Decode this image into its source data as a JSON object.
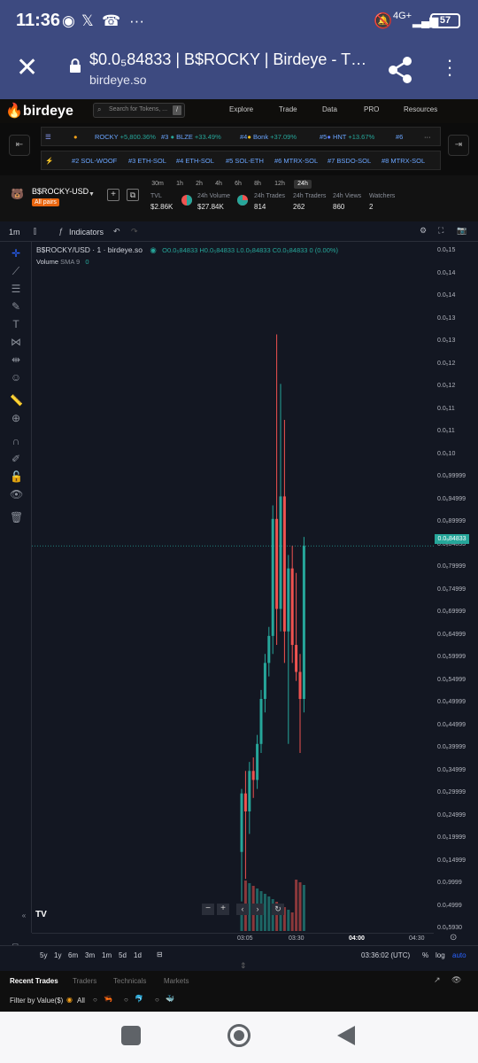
{
  "status": {
    "time": "11:36",
    "network": "4G+",
    "battery": "57"
  },
  "browser": {
    "title": "$0.0₅84833 | B$ROCKY | Birdeye - The ...",
    "url": "birdeye.so"
  },
  "site": {
    "logo": "birdeye",
    "search_placeholder": "Search for Tokens, ...",
    "search_key": "/",
    "menu": [
      "Explore",
      "Trade",
      "Data",
      "PRO",
      "Resources"
    ]
  },
  "ticker1": [
    {
      "rank": "",
      "name": "ROCKY",
      "change": "+5,800.36%"
    },
    {
      "rank": "#3",
      "name": "BLZE",
      "change": "+33.49%"
    },
    {
      "rank": "#4",
      "name": "Bonk",
      "change": "+37.09%"
    },
    {
      "rank": "#5",
      "name": "HNT",
      "change": "+13.67%"
    },
    {
      "rank": "#6",
      "name": "",
      "change": ""
    }
  ],
  "ticker2": [
    "#2 SOL-WOOF",
    "#3 ETH-SOL",
    "#4 ETH-SOL",
    "#5 SOL-ETH",
    "#6 MTRX-SOL",
    "#7 BSDO-SOL",
    "#8 MTRX-SOL"
  ],
  "token": {
    "pair": "B$ROCKY-USD",
    "badge": "All pairs",
    "timeframes": [
      "30m",
      "1h",
      "2h",
      "4h",
      "6h",
      "8h",
      "12h",
      "24h"
    ],
    "active_timeframe": "24h",
    "stats": [
      {
        "label": "TVL",
        "value": "$2.86K"
      },
      {
        "label": "24h Volume",
        "value": "$27.84K"
      },
      {
        "label": "24h Trades",
        "value": "814"
      },
      {
        "label": "24h Traders",
        "value": "262"
      },
      {
        "label": "24h Views",
        "value": "860"
      },
      {
        "label": "Watchers",
        "value": "2"
      }
    ]
  },
  "chart_toolbar": {
    "interval": "1m",
    "indicators": "Indicators"
  },
  "legend": {
    "title": "B$ROCKY/USD · 1 · birdeye.so",
    "ohlc": "O0.0₅84833 H0.0₅84833 L0.0₅84833 C0.0₅84833 0 (0.00%)",
    "volume": "Volume",
    "sma": "SMA 9",
    "sma_val": "0"
  },
  "yaxis_labels": [
    "0.0₅15",
    "0.0₅14",
    "0.0₅14",
    "0.0₅13",
    "0.0₅13",
    "0.0₅12",
    "0.0₅12",
    "0.0₅11",
    "0.0₅11",
    "0.0₅10",
    "0.0₆99999",
    "0.0₆94999",
    "0.0₆89999",
    "0.0₅84833",
    "0.0₆79999",
    "0.0₆74999",
    "0.0₆69999",
    "0.0₆64999",
    "0.0₆59999",
    "0.0₆54999",
    "0.0₆49999",
    "0.0₆44999",
    "0.0₆39999",
    "0.0₆34999",
    "0.0₆29999",
    "0.0₆24999",
    "0.0₆19999",
    "0.0₆14999",
    "0.0₇9999",
    "0.0₇4999",
    "0.0₉5930"
  ],
  "price_label": "0.0₅84833",
  "xaxis_labels": [
    "03:05",
    "03:30",
    "04:00",
    "04:30"
  ],
  "bottom": {
    "ranges": [
      "5y",
      "1y",
      "6m",
      "3m",
      "1m",
      "5d",
      "1d"
    ],
    "clock": "03:36:02 (UTC)",
    "pct": "%",
    "log": "log",
    "auto": "auto"
  },
  "tabs": [
    "Recent Trades",
    "Traders",
    "Technicals",
    "Markets"
  ],
  "filter": {
    "label": "Filter by Value($)",
    "all": "All"
  },
  "chart_data": {
    "type": "candlestick",
    "note": "1m candles",
    "candles": [
      {
        "t": 0,
        "o": 0.16,
        "h": 0.3,
        "l": 0.05,
        "c": 0.29
      },
      {
        "t": 1,
        "o": 0.29,
        "h": 0.34,
        "l": 0.1,
        "c": 0.25
      },
      {
        "t": 2,
        "o": 0.25,
        "h": 0.36,
        "l": 0.2,
        "c": 0.34
      },
      {
        "t": 3,
        "o": 0.34,
        "h": 0.37,
        "l": 0.28,
        "c": 0.32
      },
      {
        "t": 4,
        "o": 0.32,
        "h": 0.42,
        "l": 0.3,
        "c": 0.4
      },
      {
        "t": 5,
        "o": 0.4,
        "h": 0.52,
        "l": 0.38,
        "c": 0.5
      },
      {
        "t": 6,
        "o": 0.5,
        "h": 0.6,
        "l": 0.47,
        "c": 0.58
      },
      {
        "t": 7,
        "o": 0.58,
        "h": 0.66,
        "l": 0.55,
        "c": 0.64
      },
      {
        "t": 8,
        "o": 0.64,
        "h": 0.93,
        "l": 0.6,
        "c": 0.9
      },
      {
        "t": 9,
        "o": 0.9,
        "h": 1.31,
        "l": 0.62,
        "c": 0.7
      },
      {
        "t": 10,
        "o": 0.7,
        "h": 1.2,
        "l": 0.65,
        "c": 0.95
      },
      {
        "t": 11,
        "o": 0.95,
        "h": 1.12,
        "l": 0.58,
        "c": 0.65
      },
      {
        "t": 12,
        "o": 0.65,
        "h": 0.82,
        "l": 0.4,
        "c": 0.79
      },
      {
        "t": 13,
        "o": 0.79,
        "h": 0.84,
        "l": 0.58,
        "c": 0.62
      },
      {
        "t": 14,
        "o": 0.62,
        "h": 0.78,
        "l": 0.54,
        "c": 0.56
      },
      {
        "t": 15,
        "o": 0.56,
        "h": 0.6,
        "l": 0.38,
        "c": 0.5
      },
      {
        "t": 16,
        "o": 0.5,
        "h": 0.86,
        "l": 0.47,
        "c": 0.84
      }
    ],
    "ylim": [
      0.0,
      1.5
    ]
  },
  "colors": {
    "up": "#26a69a",
    "down": "#ef5350",
    "accent": "#f7a21a",
    "statusbar": "#3d4a80"
  }
}
